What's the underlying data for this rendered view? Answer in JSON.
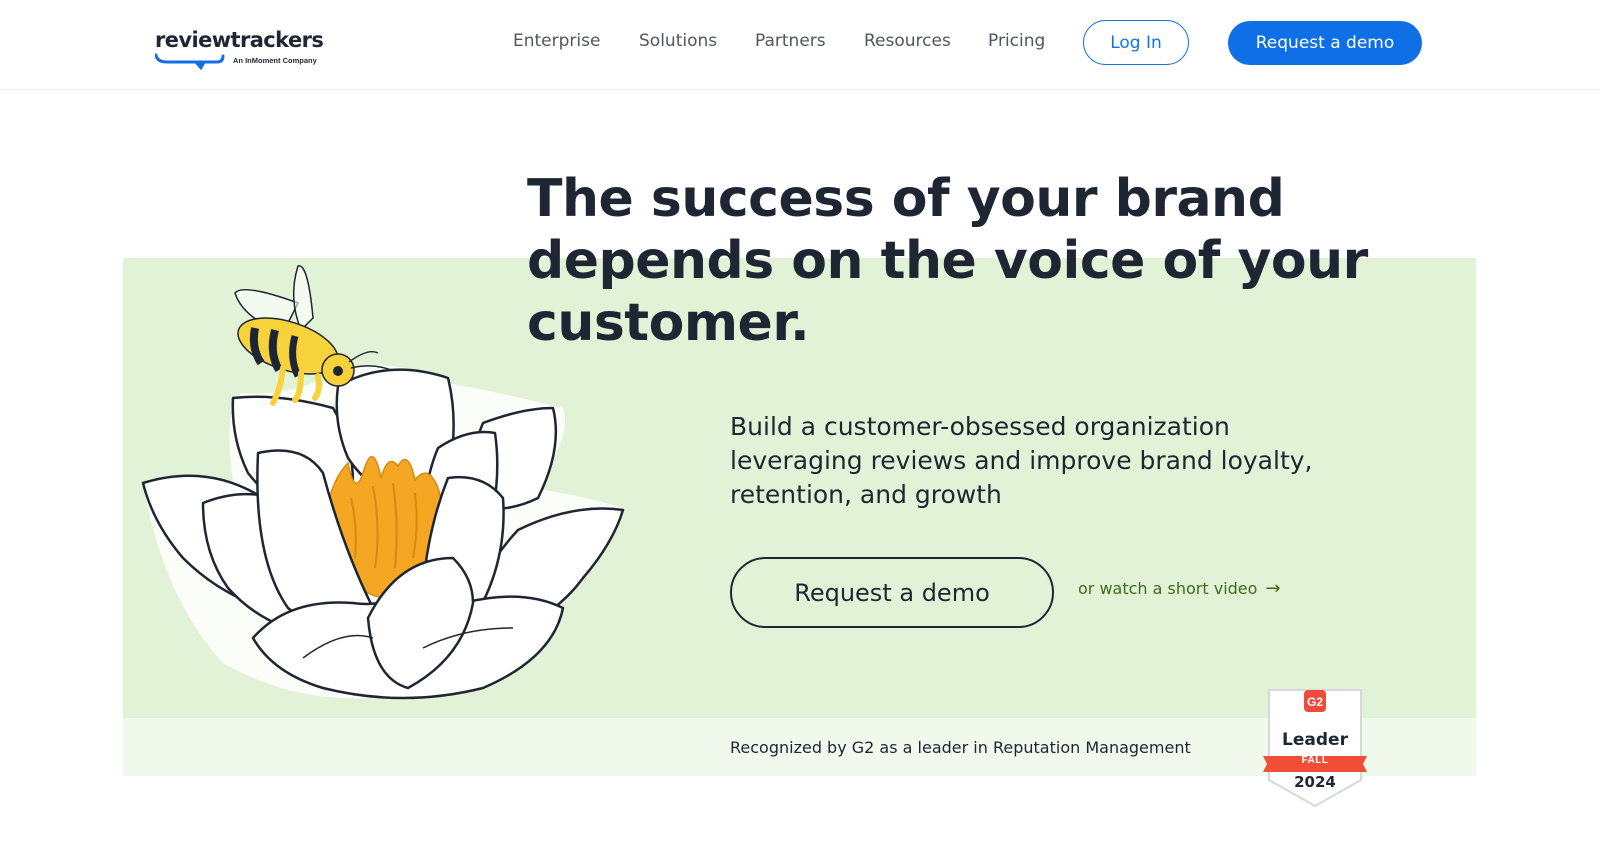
{
  "brand": {
    "name": "reviewtrackers",
    "tagline": "An InMoment Company",
    "accent": "#0f6fe6"
  },
  "nav": {
    "items": [
      {
        "label": "Enterprise"
      },
      {
        "label": "Solutions"
      },
      {
        "label": "Partners"
      },
      {
        "label": "Resources"
      },
      {
        "label": "Pricing"
      }
    ],
    "login_label": "Log In",
    "demo_label": "Request a demo"
  },
  "hero": {
    "headline": "The success of your brand depends on the voice of your customer.",
    "subtext": "Build a customer-obsessed organization leveraging reviews and improve brand loyalty, retention, and growth",
    "cta_label": "Request a demo",
    "video_link_label": "or watch a short video",
    "background_color": "#e2f2d6",
    "illustration": "bee-on-water-lily"
  },
  "recognition": {
    "text": "Recognized by G2 as a leader in Reputation Management",
    "badge": {
      "logo": "G2",
      "title": "Leader",
      "season": "FALL",
      "year": "2024"
    }
  }
}
